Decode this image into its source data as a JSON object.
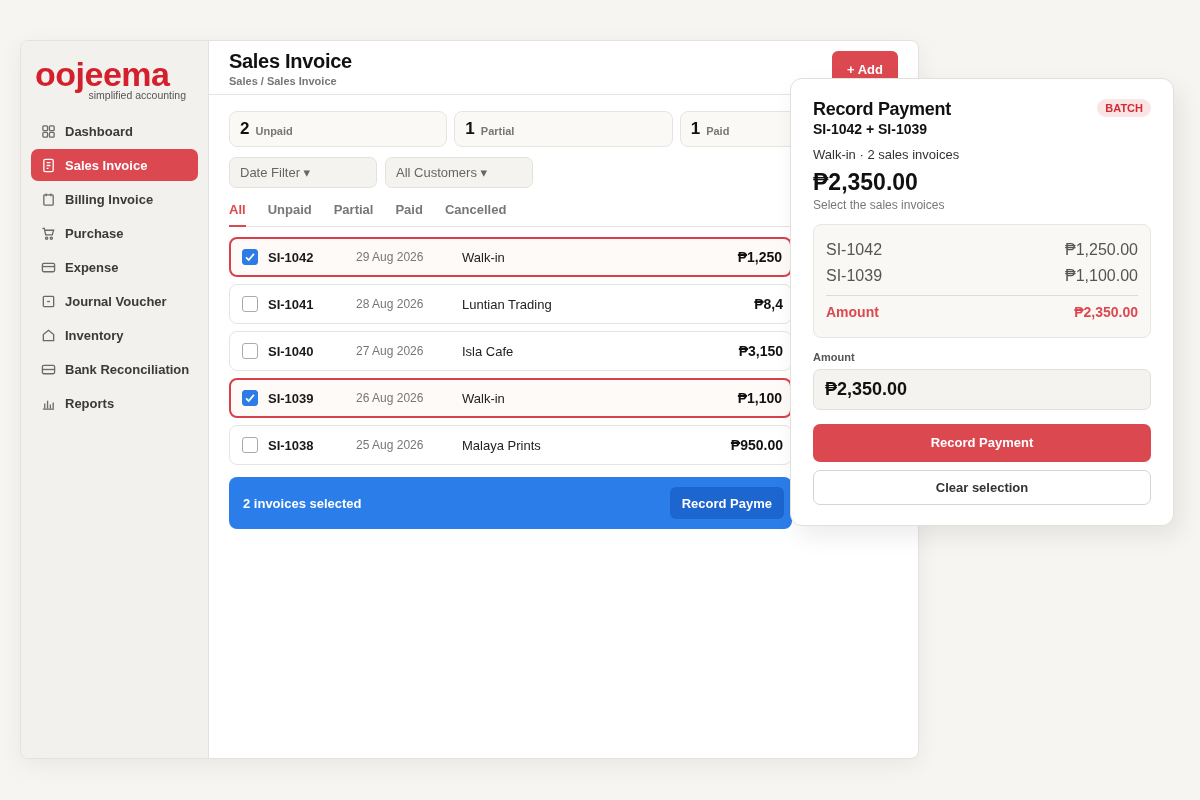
{
  "logo": {
    "name": "oojeema",
    "tagline": "simplified accounting"
  },
  "sidebar": {
    "items": [
      {
        "label": "Dashboard",
        "selected": false
      },
      {
        "label": "Sales Invoice",
        "selected": true
      },
      {
        "label": "Billing Invoice",
        "selected": false
      },
      {
        "label": "Purchase",
        "selected": false
      },
      {
        "label": "Expense",
        "selected": false
      },
      {
        "label": "Journal Voucher",
        "selected": false
      },
      {
        "label": "Inventory",
        "selected": false
      },
      {
        "label": "Bank Reconciliation",
        "selected": false
      },
      {
        "label": "Reports",
        "selected": false
      }
    ]
  },
  "header": {
    "title": "Sales Invoice",
    "breadcrumb": "Sales / Sales Invoice",
    "add_button": "+ Add"
  },
  "stats": [
    {
      "count": "2",
      "label": "Unpaid"
    },
    {
      "count": "1",
      "label": "Partial"
    },
    {
      "count": "1",
      "label": "Paid"
    }
  ],
  "filters": [
    "Date Filter ▾",
    "All Customers ▾"
  ],
  "tabs": [
    {
      "label": "All",
      "selected": true
    },
    {
      "label": "Unpaid",
      "selected": false
    },
    {
      "label": "Partial",
      "selected": false
    },
    {
      "label": "Paid",
      "selected": false
    },
    {
      "label": "Cancelled",
      "selected": false
    }
  ],
  "rows": [
    {
      "id": "SI-1042",
      "date": "29 Aug 2026",
      "customer": "Walk-in",
      "amount": "₱1,250",
      "checked": true
    },
    {
      "id": "SI-1041",
      "date": "28 Aug 2026",
      "customer": "Luntian Trading",
      "amount": "₱8,4",
      "checked": false
    },
    {
      "id": "SI-1040",
      "date": "27 Aug 2026",
      "customer": "Isla Cafe",
      "amount": "₱3,150",
      "checked": false
    },
    {
      "id": "SI-1039",
      "date": "26 Aug 2026",
      "customer": "Walk-in",
      "amount": "₱1,100",
      "checked": true
    },
    {
      "id": "SI-1038",
      "date": "25 Aug 2026",
      "customer": "Malaya Prints",
      "amount": "₱950.00",
      "checked": false
    }
  ],
  "selection_bar": {
    "text": "2 invoices selected",
    "button": "Record Payme"
  },
  "popover": {
    "title": "Record Payment",
    "badge": "BATCH",
    "subtitle": "SI-1042 + SI-1039",
    "meta": "Walk-in · 2 sales invoices",
    "total": "₱2,350.00",
    "hint": "Select the sales invoices",
    "lines": [
      {
        "id": "SI-1042",
        "amount": "₱1,250.00"
      },
      {
        "id": "SI-1039",
        "amount": "₱1,100.00"
      }
    ],
    "sum": {
      "label": "Amount",
      "amount": "₱2,350.00"
    },
    "field": {
      "label": "Amount",
      "value": "₱2,350.00"
    },
    "primary_button": "Record Payment",
    "secondary_button": "Clear selection"
  }
}
